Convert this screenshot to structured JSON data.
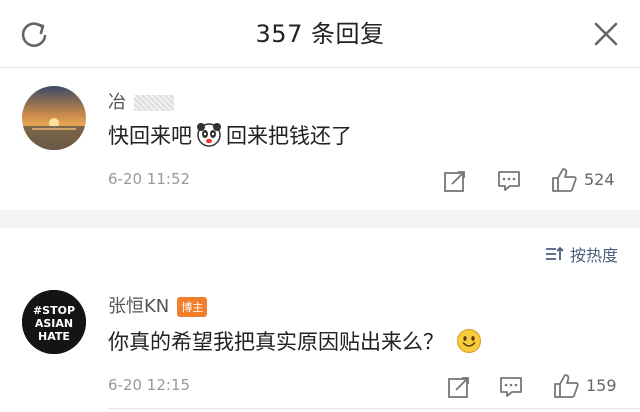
{
  "header": {
    "title": "357 条回复"
  },
  "comments": [
    {
      "username": "冶",
      "text_before_emoji": "快回来吧",
      "emoji": "panda-face-emoji",
      "text_after_emoji": "回来把钱还了",
      "time": "6-20 11:52",
      "likes": "524",
      "avatar": "sunset-sea-avatar"
    },
    {
      "username": "张恒KN",
      "badge": "博主",
      "text": "你真的希望我把真实原因贴出来么？",
      "emoji": "smile-emoji",
      "time": "6-20 12:15",
      "likes": "159",
      "avatar": "stop-asian-hate-avatar",
      "avatar_text": "#STOP ASIAN HATE"
    }
  ],
  "sort": {
    "label": "按热度"
  },
  "colors": {
    "accent_link": "#4a5f7d",
    "badge": "#f07f2b"
  }
}
